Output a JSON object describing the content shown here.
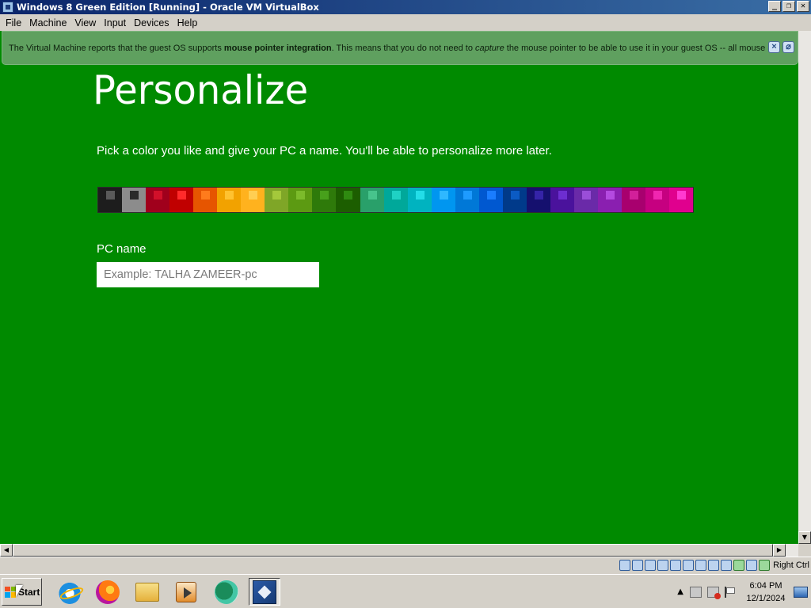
{
  "window": {
    "title": "Windows 8 Green Edition [Running] - Oracle VM VirtualBox",
    "controls": {
      "minimize": "_",
      "restore": "❐",
      "close": "✕"
    }
  },
  "menubar": [
    "File",
    "Machine",
    "View",
    "Input",
    "Devices",
    "Help"
  ],
  "notice": {
    "prefix": "The Virtual Machine reports that the guest OS supports ",
    "bold": "mouse pointer integration",
    "middle": ". This means that you do not need to ",
    "italic": "capture",
    "suffix": " the mouse pointer to be able to use it in your guest OS -- all mouse"
  },
  "setup": {
    "title": "Personalize",
    "description": "Pick a color you like and give your PC a name. You'll be able to personalize more later.",
    "pc_name_label": "PC name",
    "pc_name_placeholder": "Example: TALHA ZAMEER-pc",
    "pc_name_value": "",
    "swatches": [
      {
        "bg": "#1d1d1d",
        "accent": "#5a5a5a"
      },
      {
        "bg": "#8c8c8c",
        "accent": "#2a2a2a"
      },
      {
        "bg": "#a0001c",
        "accent": "#d1102a"
      },
      {
        "bg": "#c00000",
        "accent": "#ff2a2a"
      },
      {
        "bg": "#e65500",
        "accent": "#ff7b1c"
      },
      {
        "bg": "#f2a200",
        "accent": "#ffc230"
      },
      {
        "bg": "#ffb21e",
        "accent": "#ffce52"
      },
      {
        "bg": "#7fa627",
        "accent": "#a4c83b"
      },
      {
        "bg": "#5c9a12",
        "accent": "#7cbb2b"
      },
      {
        "bg": "#2e7a0a",
        "accent": "#47a01b"
      },
      {
        "bg": "#1c5e00",
        "accent": "#2f8a10"
      },
      {
        "bg": "#29a06a",
        "accent": "#47c48c"
      },
      {
        "bg": "#00a89a",
        "accent": "#1fd2c4"
      },
      {
        "bg": "#00b3c0",
        "accent": "#23dde8"
      },
      {
        "bg": "#0096f0",
        "accent": "#2fb8ff"
      },
      {
        "bg": "#0078d7",
        "accent": "#1e9bff"
      },
      {
        "bg": "#0058d0",
        "accent": "#1a7dff"
      },
      {
        "bg": "#003a8a",
        "accent": "#0b5bc4"
      },
      {
        "bg": "#15106e",
        "accent": "#3524a8"
      },
      {
        "bg": "#4a129c",
        "accent": "#6d2ed0"
      },
      {
        "bg": "#6a2aa8",
        "accent": "#9a4ed8"
      },
      {
        "bg": "#8a1fb0",
        "accent": "#b44ae0"
      },
      {
        "bg": "#a8006e",
        "accent": "#d2209a"
      },
      {
        "bg": "#c60080",
        "accent": "#f026b0"
      },
      {
        "bg": "#e0008e",
        "accent": "#ff3ad0"
      }
    ]
  },
  "vbox_status": {
    "host_key": "Right Ctrl"
  },
  "taskbar": {
    "start_label": "Start",
    "apps": [
      {
        "name": "internet-explorer",
        "icon": "ie-icon"
      },
      {
        "name": "firefox",
        "icon": "firefox-icon"
      },
      {
        "name": "file-explorer",
        "icon": "folder-icon"
      },
      {
        "name": "media-player",
        "icon": "media-icon"
      },
      {
        "name": "chat-app",
        "icon": "chat-bubble-icon"
      },
      {
        "name": "virtualbox",
        "icon": "virtualbox-icon",
        "active": true
      }
    ],
    "clock_time": "6:04 PM",
    "clock_date": "12/1/2024"
  }
}
